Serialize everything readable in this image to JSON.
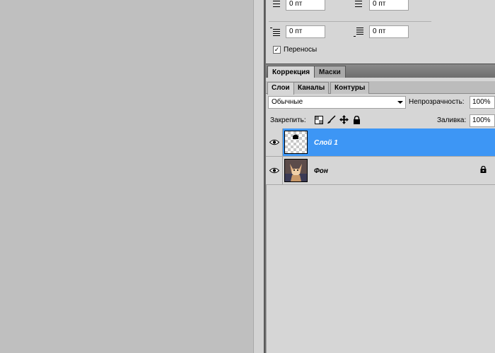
{
  "paragraph": {
    "indent_top_left": "0 пт",
    "indent_top_right": "0 пт",
    "space_before": "0 пт",
    "space_after": "0 пт",
    "hyphenation_label": "Переносы",
    "hyphenation_checked": "✓"
  },
  "adjustments": {
    "tabs": [
      "Коррекция",
      "Маски"
    ]
  },
  "layers": {
    "tabs": [
      "Слои",
      "Каналы",
      "Контуры"
    ],
    "blend_mode": "Обычные",
    "opacity_label": "Непрозрачность:",
    "opacity_value": "100%",
    "lock_label": "Закрепить:",
    "fill_label": "Заливка:",
    "fill_value": "100%",
    "list": [
      {
        "name": "Слой 1",
        "selected": true
      },
      {
        "name": "Фон",
        "locked": true
      }
    ]
  },
  "colors": {
    "selection": "#3d96f5",
    "panel_bg": "#d6d6d6",
    "canvas_bg": "#bfbfbf"
  }
}
